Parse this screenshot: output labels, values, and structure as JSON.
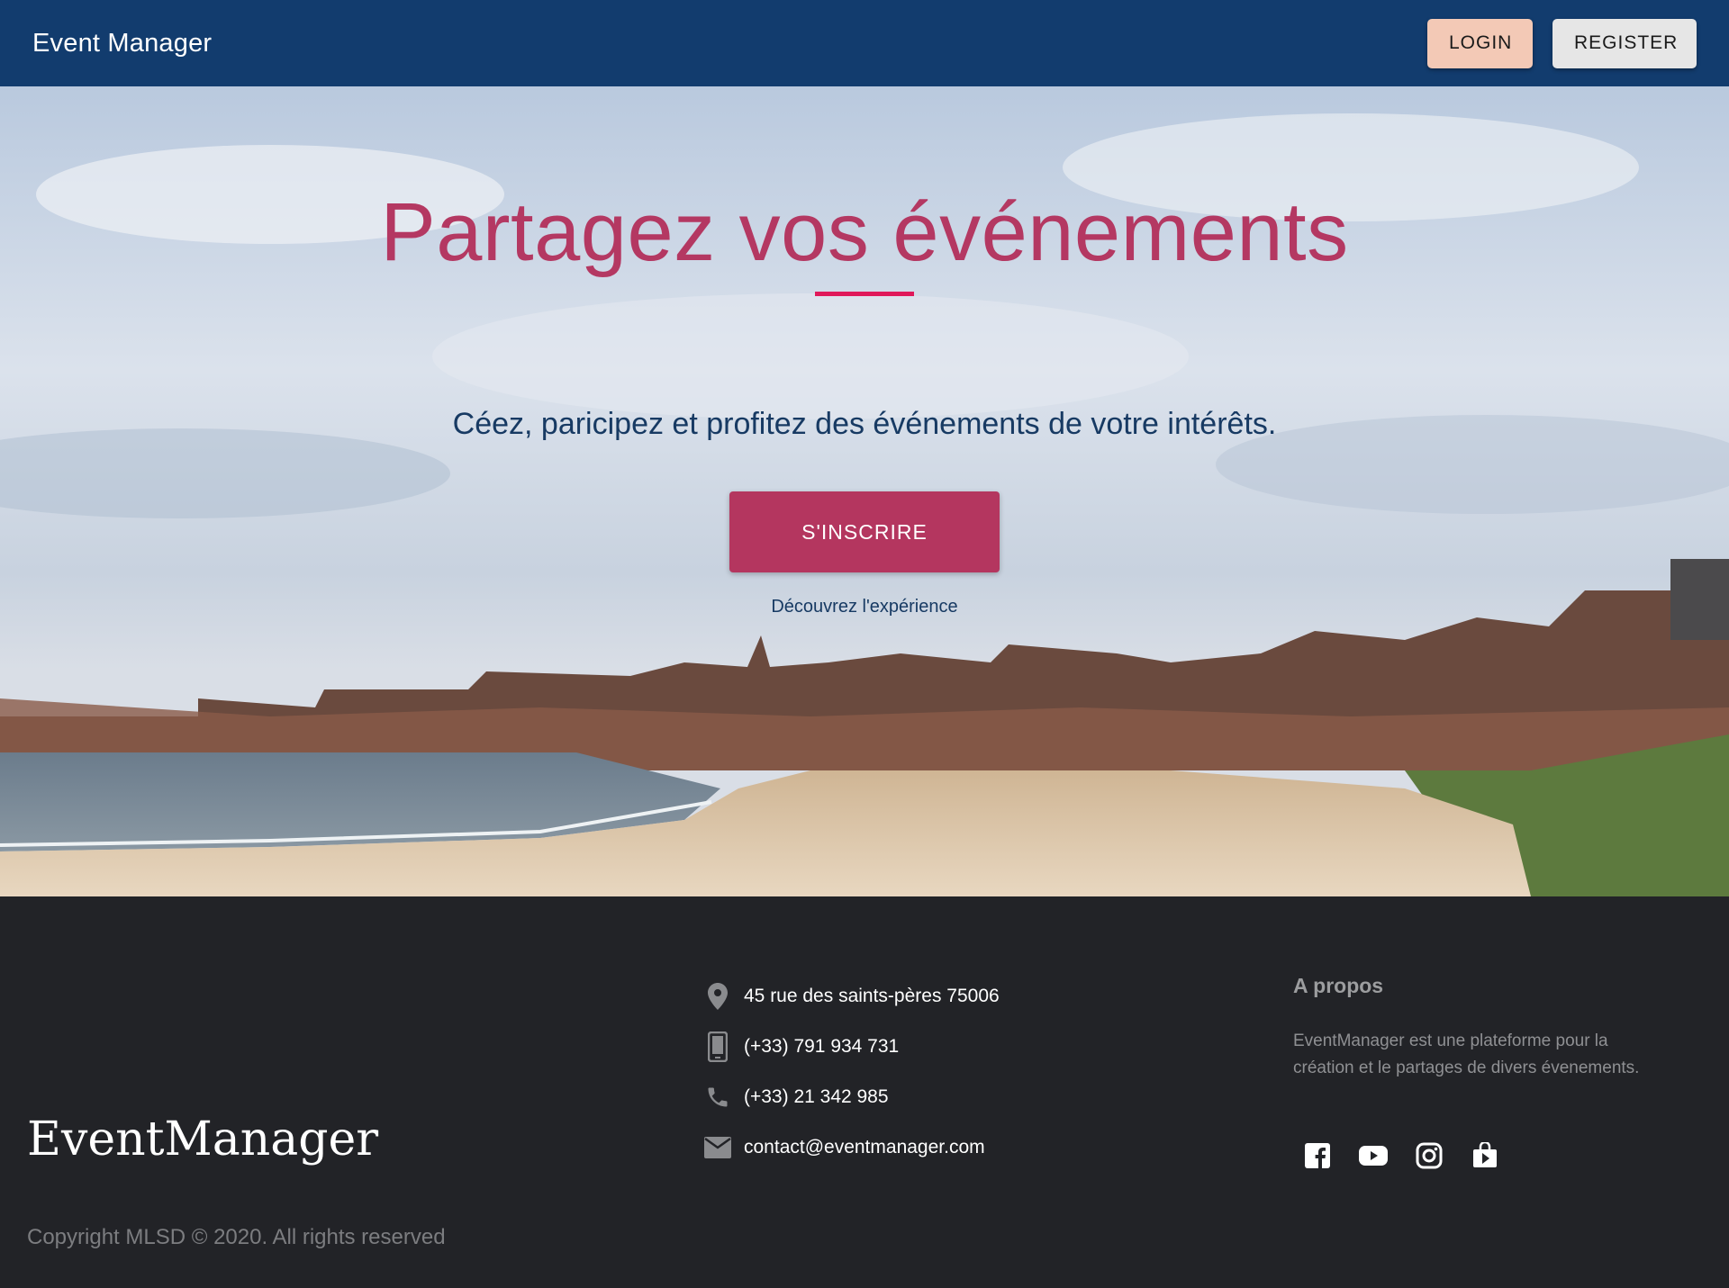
{
  "header": {
    "brand": "Event Manager",
    "login_label": "LOGIN",
    "register_label": "REGISTER"
  },
  "hero": {
    "title": "Partagez vos événements",
    "subtitle": "Céez, paricipez et profitez des événements de votre intérêts.",
    "cta_label": "S'INSCRIRE",
    "note": "Découvrez l'expérience"
  },
  "footer": {
    "logo": "EventManager",
    "copyright": "Copyright MLSD © 2020. All rights reserved",
    "contact": {
      "address": "45 rue des saints-pères 75006",
      "mobile": "(+33) 791 934 731",
      "phone": "(+33) 21 342 985",
      "email": "contact@eventmanager.com"
    },
    "about": {
      "title": "A propos",
      "text": "EventManager est une plateforme pour la création et le partages de divers évenements."
    },
    "socials": [
      "facebook-icon",
      "youtube-icon",
      "instagram-icon",
      "play-store-icon"
    ]
  },
  "colors": {
    "header_bg": "#123c6e",
    "accent": "#b4365f",
    "title": "#b43862",
    "rule": "#e0195a",
    "footer_bg": "#222327"
  }
}
